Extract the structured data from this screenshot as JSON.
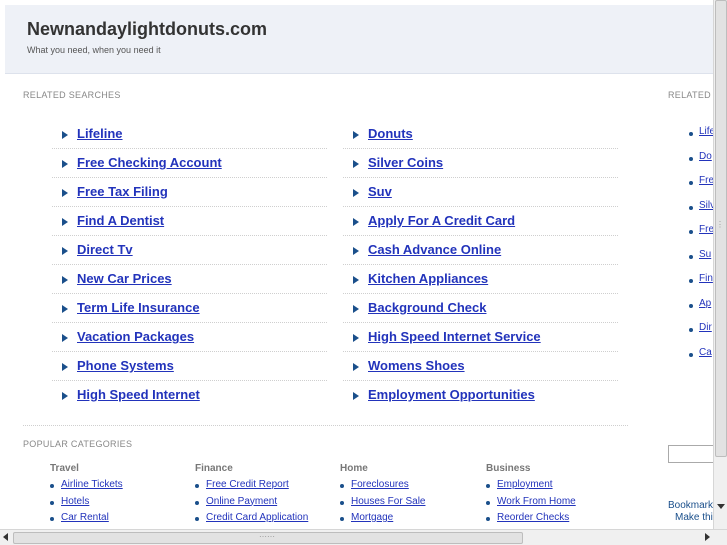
{
  "header": {
    "title": "Newnandaylightdonuts.com",
    "tagline": "What you need, when you need it"
  },
  "related": {
    "label": "RELATED SEARCHES",
    "left": [
      "Lifeline",
      "Free Checking Account",
      "Free Tax Filing",
      "Find A Dentist",
      "Direct Tv",
      "New Car Prices",
      "Term Life Insurance",
      "Vacation Packages",
      "Phone Systems",
      "High Speed Internet"
    ],
    "right": [
      "Donuts",
      "Silver Coins",
      "Suv",
      "Apply For A Credit Card",
      "Cash Advance Online",
      "Kitchen Appliances",
      "Background Check",
      "High Speed Internet Service",
      "Womens Shoes",
      "Employment Opportunities"
    ]
  },
  "sidebar": {
    "label": "RELATED",
    "items": [
      "Life",
      "Do",
      "Fre",
      "Silv",
      "Fre",
      "Su",
      "Fin",
      "Ap",
      "Dir",
      "Ca"
    ],
    "bookmark": "Bookmark",
    "make": "Make thi"
  },
  "popular": {
    "label": "POPULAR CATEGORIES",
    "cats": [
      {
        "name": "Travel",
        "items": [
          "Airline Tickets",
          "Hotels",
          "Car Rental"
        ]
      },
      {
        "name": "Finance",
        "items": [
          "Free Credit Report",
          "Online Payment",
          "Credit Card Application"
        ]
      },
      {
        "name": "Home",
        "items": [
          "Foreclosures",
          "Houses For Sale",
          "Mortgage"
        ]
      },
      {
        "name": "Business",
        "items": [
          "Employment",
          "Work From Home",
          "Reorder Checks"
        ]
      }
    ]
  },
  "colors": {
    "link": "#2233bb",
    "accent": "#1a4f8b",
    "header_bg": "#eef1f7"
  }
}
